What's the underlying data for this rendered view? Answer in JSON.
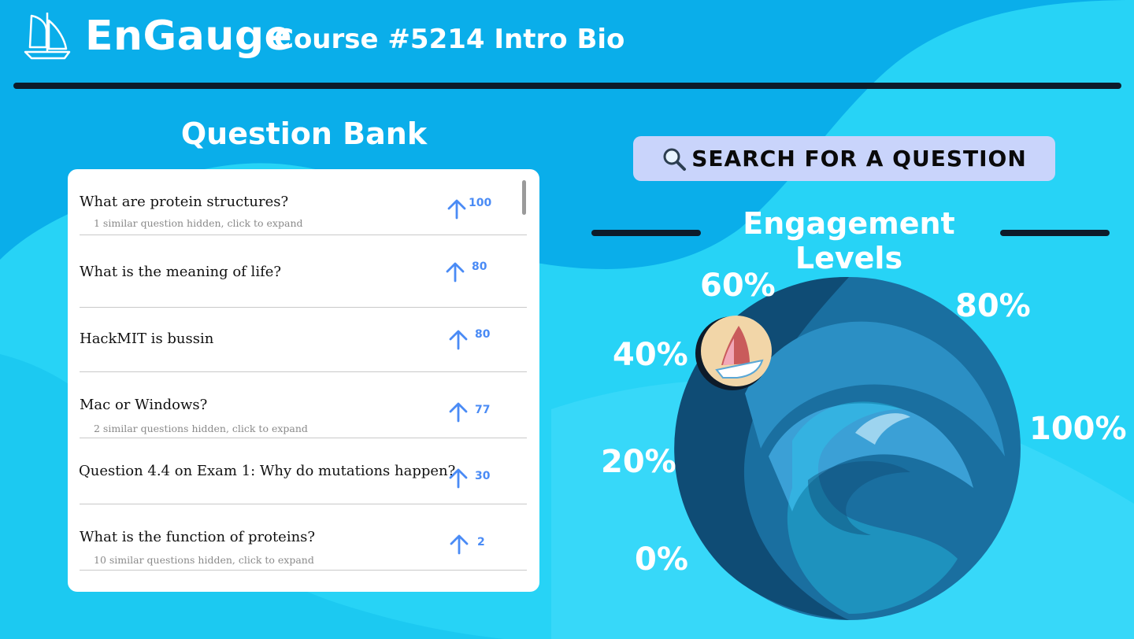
{
  "header": {
    "brand": "EnGauge",
    "course": "Course #5214 Intro Bio"
  },
  "question_bank": {
    "title": "Question Bank",
    "questions": [
      {
        "text": "What are protein structures?",
        "sub": "1 similar question hidden, click to expand",
        "votes": "100"
      },
      {
        "text": "What is the meaning of life?",
        "sub": "",
        "votes": "80"
      },
      {
        "text": "HackMIT is bussin",
        "sub": "",
        "votes": "80"
      },
      {
        "text": "Mac or Windows?",
        "sub": "2 similar questions hidden, click to expand",
        "votes": "77"
      },
      {
        "text": "Question 4.4 on Exam 1: Why do mutations happen?",
        "sub": "",
        "votes": "30"
      },
      {
        "text": "What is the function of proteins?",
        "sub": "10 similar questions hidden, click to expand",
        "votes": "2"
      }
    ]
  },
  "search": {
    "label": "SEARCH FOR A QUESTION",
    "icon": "magnifier-icon"
  },
  "engagement": {
    "title": "Engagement Levels",
    "scale": [
      "0%",
      "20%",
      "40%",
      "60%",
      "80%",
      "100%"
    ],
    "current_level_fraction": 0.5
  },
  "colors": {
    "background": "#27d3f6",
    "header_band": "#0aaeea",
    "accent_blue": "#4a8bf5",
    "dark_rule": "#0d1b2a",
    "search_bg": "#c9d4fb"
  }
}
